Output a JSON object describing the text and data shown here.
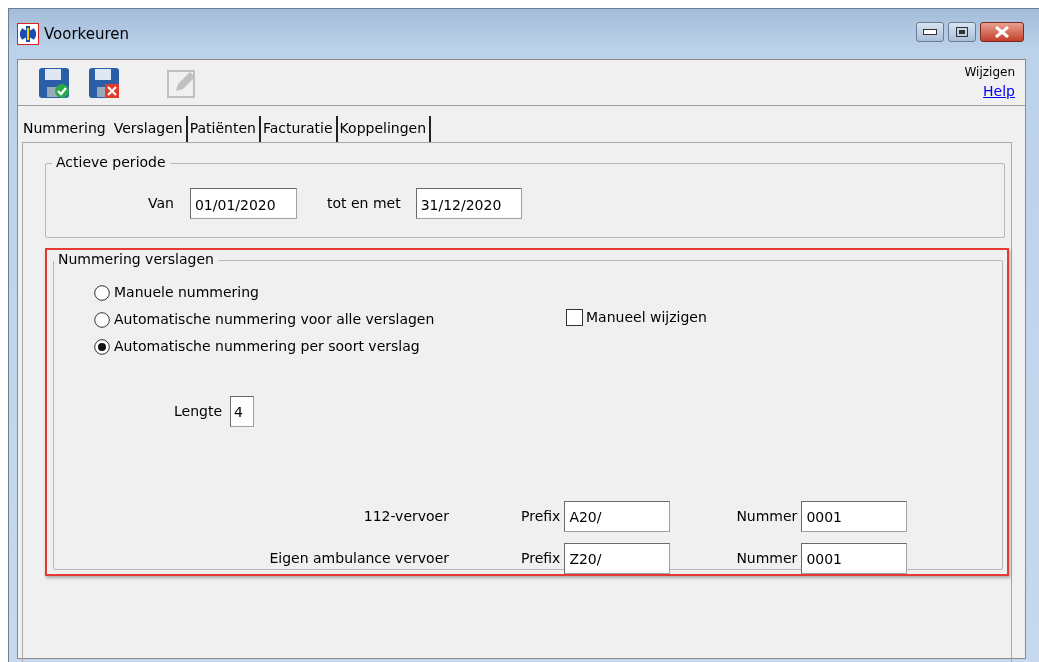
{
  "window": {
    "title": "Voorkeuren"
  },
  "toolbar": {
    "buttons": [
      {
        "kind": "save",
        "disabled": false
      },
      {
        "kind": "cancel",
        "disabled": false
      },
      {
        "kind": "edit",
        "disabled": true
      }
    ],
    "mode": "Wijzigen",
    "help_link": "Help"
  },
  "tabs": [
    {
      "label": "Nummering",
      "selected": true
    },
    {
      "label": "Verslagen",
      "selected": false
    },
    {
      "label": "Patiënten",
      "selected": false
    },
    {
      "label": "Facturatie",
      "selected": false
    },
    {
      "label": "Koppelingen",
      "selected": false
    }
  ],
  "active_period": {
    "title": "Actieve periode",
    "from_label": "Van",
    "from": "01/01/2020",
    "to_label": "tot en met",
    "to": "31/12/2020"
  },
  "numbering": {
    "title": "Nummering verslagen",
    "highlighted": true,
    "options": [
      {
        "label": "Manuele nummering",
        "selected": false
      },
      {
        "label": "Automatische nummering voor alle verslagen",
        "selected": false
      },
      {
        "label": "Automatische nummering per soort verslag",
        "selected": true
      }
    ],
    "manual_edit": {
      "label": "Manueel wijzigen",
      "checked": false
    },
    "length_label": "Lengte",
    "length": "4",
    "report_types": [
      {
        "name": "112-vervoer",
        "prefix_label": "Prefix",
        "prefix": "A20/",
        "number_label": "Nummer",
        "number": "0001"
      },
      {
        "name": "Eigen ambulance vervoer",
        "prefix_label": "Prefix",
        "prefix": "Z20/",
        "number_label": "Nummer",
        "number": "0001"
      }
    ]
  }
}
